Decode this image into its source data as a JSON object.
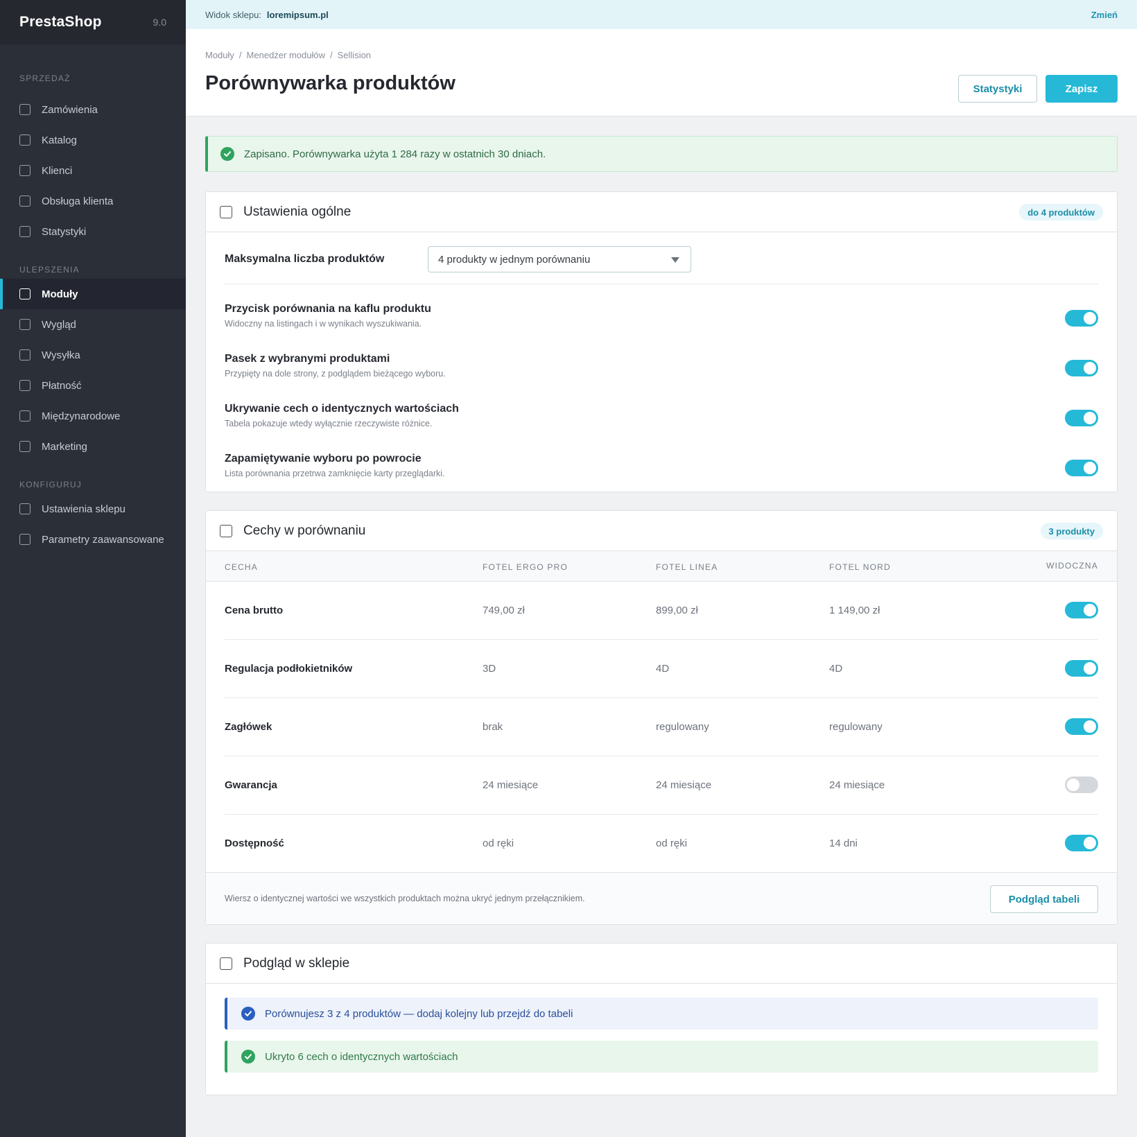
{
  "sidebar": {
    "brand": "PrestaShop",
    "version": "9.0",
    "sections": [
      {
        "title": "SPRZEDAŻ",
        "items": [
          "Zamówienia",
          "Katalog",
          "Klienci",
          "Obsługa klienta",
          "Statystyki"
        ]
      },
      {
        "title": "ULEPSZENIA",
        "items": [
          "Moduły",
          "Wygląd",
          "Wysyłka",
          "Płatność",
          "Międzynarodowe",
          "Marketing"
        ]
      },
      {
        "title": "KONFIGURUJ",
        "items": [
          "Ustawienia sklepu",
          "Parametry zaawansowane"
        ]
      }
    ],
    "active_item": "Moduły"
  },
  "topbar": {
    "label": "Widok sklepu:",
    "shop": "loremipsum.pl",
    "change": "Zmień"
  },
  "header": {
    "breadcrumb": [
      "Moduły",
      "Menedżer modułów",
      "Sellision"
    ],
    "title": "Porównywarka produktów",
    "stats_button": "Statystyki",
    "save_button": "Zapisz"
  },
  "alert": {
    "text": "Zapisano. Porównywarka użyta 1 284 razy w ostatnich 30 dniach."
  },
  "general": {
    "title": "Ustawienia ogólne",
    "badge": "do 4 produktów",
    "max_label": "Maksymalna liczba produktów",
    "max_value": "4 produkty w jednym porównaniu",
    "settings": [
      {
        "label": "Przycisk porównania na kaflu produktu",
        "sub": "Widoczny na listingach i w wynikach wyszukiwania.",
        "on": true
      },
      {
        "label": "Pasek z wybranymi produktami",
        "sub": "Przypięty na dole strony, z podglądem bieżącego wyboru.",
        "on": true
      },
      {
        "label": "Ukrywanie cech o identycznych wartościach",
        "sub": "Tabela pokazuje wtedy wyłącznie rzeczywiste różnice.",
        "on": true
      },
      {
        "label": "Zapamiętywanie wyboru po powrocie",
        "sub": "Lista porównania przetrwa zamknięcie karty przeglądarki.",
        "on": true
      }
    ]
  },
  "features": {
    "title": "Cechy w porównaniu",
    "badge": "3 produkty",
    "columns": [
      "CECHA",
      "FOTEL ERGO PRO",
      "FOTEL LINEA",
      "FOTEL NORD",
      "WIDOCZNA"
    ],
    "rows": [
      {
        "name": "Cena brutto",
        "values": [
          "749,00 zł",
          "899,00 zł",
          "1 149,00 zł"
        ],
        "visible": true
      },
      {
        "name": "Regulacja podłokietników",
        "values": [
          "3D",
          "4D",
          "4D"
        ],
        "visible": true
      },
      {
        "name": "Zagłówek",
        "values": [
          "brak",
          "regulowany",
          "regulowany"
        ],
        "visible": true
      },
      {
        "name": "Gwarancja",
        "values": [
          "24 miesiące",
          "24 miesiące",
          "24 miesiące"
        ],
        "visible": false
      },
      {
        "name": "Dostępność",
        "values": [
          "od ręki",
          "od ręki",
          "14 dni"
        ],
        "visible": true
      }
    ],
    "footer_note": "Wiersz o identycznej wartości we wszystkich produktach można ukryć jednym przełącznikiem.",
    "preview_button": "Podgląd tabeli"
  },
  "preview": {
    "title": "Podgląd w sklepie",
    "info": "Porównujesz 3 z 4 produktów — dodaj kolejny lub przejdź do tabeli",
    "ok": "Ukryto 6 cech o identycznych wartościach"
  },
  "colors": {
    "accent": "#25b9d7",
    "sidebar": "#2b2f38",
    "success": "#2fa35f",
    "info": "#2a5fbf"
  }
}
